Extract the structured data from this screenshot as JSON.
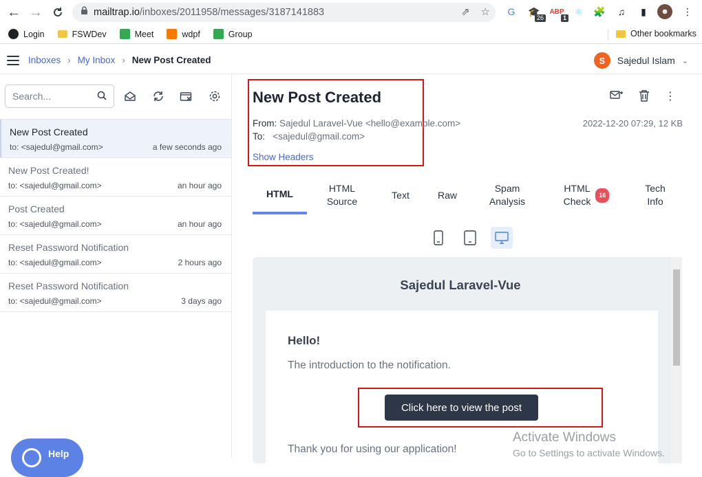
{
  "browser": {
    "url_host": "mailtrap.io",
    "url_path": "/inboxes/2011958/messages/3187141883",
    "extension_badges": [
      "26",
      "1"
    ],
    "bookmarks": [
      "Login",
      "FSWDev",
      "Meet",
      "wdpf",
      "Group"
    ],
    "other_bookmarks": "Other bookmarks"
  },
  "header": {
    "breadcrumb": [
      "Inboxes",
      "My Inbox",
      "New Post Created"
    ],
    "user_initial": "S",
    "user_name": "Sajedul Islam"
  },
  "sidebar": {
    "search_placeholder": "Search...",
    "messages": [
      {
        "subject": "New Post Created",
        "to": "to: <sajedul@gmail.com>",
        "time": "a few seconds ago",
        "active": true
      },
      {
        "subject": "New Post Created!",
        "to": "to: <sajedul@gmail.com>",
        "time": "an hour ago",
        "active": false
      },
      {
        "subject": "Post Created",
        "to": "to: <sajedul@gmail.com>",
        "time": "an hour ago",
        "active": false
      },
      {
        "subject": "Reset Password Notification",
        "to": "to: <sajedul@gmail.com>",
        "time": "2 hours ago",
        "active": false
      },
      {
        "subject": "Reset Password Notification",
        "to": "to: <sajedul@gmail.com>",
        "time": "3 days ago",
        "active": false
      }
    ],
    "help_label": "Help"
  },
  "message": {
    "title": "New Post Created",
    "from_label": "From:",
    "from_value": "Sajedul Laravel-Vue <hello@example.com>",
    "to_label": "To:",
    "to_value": "<sajedul@gmail.com>",
    "show_headers": "Show Headers",
    "meta": "2022-12-20 07:29, 12 KB"
  },
  "tabs": [
    {
      "line1": "HTML",
      "line2": ""
    },
    {
      "line1": "HTML",
      "line2": "Source"
    },
    {
      "line1": "Text",
      "line2": ""
    },
    {
      "line1": "Raw",
      "line2": ""
    },
    {
      "line1": "Spam",
      "line2": "Analysis"
    },
    {
      "line1": "HTML",
      "line2": "Check"
    },
    {
      "line1": "Tech",
      "line2": "Info"
    }
  ],
  "html_check_count": "16",
  "preview": {
    "app_name": "Sajedul Laravel-Vue",
    "greeting": "Hello!",
    "intro": "The introduction to the notification.",
    "cta": "Click here to view the post",
    "thanks": "Thank you for using our application!"
  },
  "watermark": {
    "line1": "Activate Windows",
    "line2": "Go to Settings to activate Windows."
  },
  "colors": {
    "accent": "#4a68c9",
    "tab_underline": "#5f89e6",
    "highlight_box": "#d8141b",
    "avatar": "#f06423",
    "cta_bg": "#2d3748",
    "badge": "#e8505b"
  }
}
